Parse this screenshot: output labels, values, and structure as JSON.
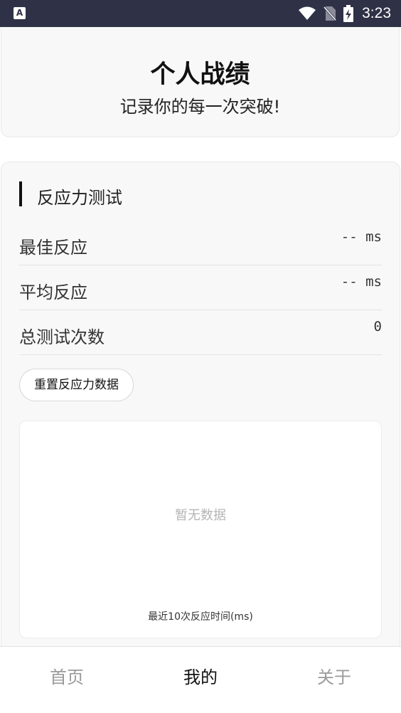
{
  "status_bar": {
    "app_icon_letter": "A",
    "time": "3:23",
    "icons": [
      "wifi-icon",
      "no-sim-icon",
      "battery-charging-icon"
    ]
  },
  "header": {
    "title": "个人战绩",
    "subtitle": "记录你的每一次突破!"
  },
  "reaction_section": {
    "title": "反应力测试",
    "stats": [
      {
        "label": "最佳反应",
        "value": "-- ms"
      },
      {
        "label": "平均反应",
        "value": "-- ms"
      },
      {
        "label": "总测试次数",
        "value": "0"
      }
    ],
    "reset_label": "重置反应力数据",
    "chart": {
      "empty_text": "暂无数据",
      "caption": "最近10次反应时间(ms)"
    }
  },
  "bottom_nav": {
    "items": [
      {
        "label": "首页",
        "active": false
      },
      {
        "label": "我的",
        "active": true
      },
      {
        "label": "关于",
        "active": false
      }
    ]
  }
}
